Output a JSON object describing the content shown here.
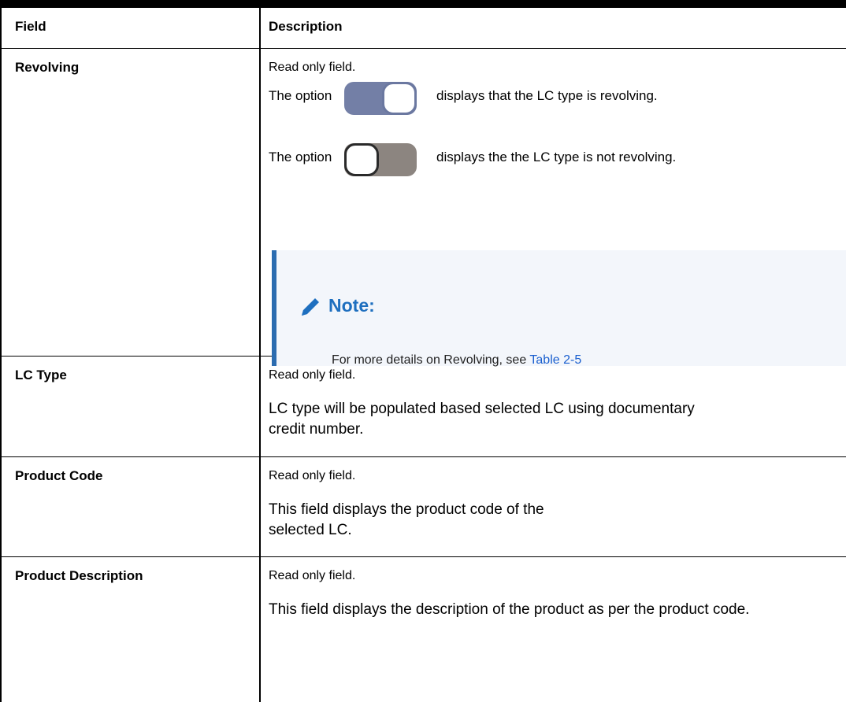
{
  "headers": {
    "field": "Field",
    "description": "Description"
  },
  "rows": [
    {
      "field": "Revolving",
      "lines": [
        "Read only field."
      ],
      "toggle_on": {
        "lead": "The option",
        "trail": "displays that the LC type is revolving."
      },
      "toggle_off": {
        "lead": "The option",
        "trail": "displays the the LC type is not revolving."
      },
      "note": {
        "title": "Note:",
        "text": "For more details on Revolving, see ",
        "link": "Table 2-5",
        "icon": "pencil-icon"
      }
    },
    {
      "field": "LC Type",
      "lines": [
        "Read only field.",
        "LC type will be populated based selected LC using documentary credit number."
      ]
    },
    {
      "field": "Product Code",
      "lines": [
        "Read only field.",
        "This field displays the product code of the selected LC."
      ]
    },
    {
      "field": "Product Description",
      "lines": [
        "Read only field.",
        "This field displays the description of the product as per the product code."
      ]
    }
  ],
  "colors": {
    "note_accent": "#2b6cb0",
    "note_title": "#1e6fbf",
    "link": "#1a5fcf",
    "toggle_on": "#737fa6",
    "toggle_off": "#8c8580"
  }
}
